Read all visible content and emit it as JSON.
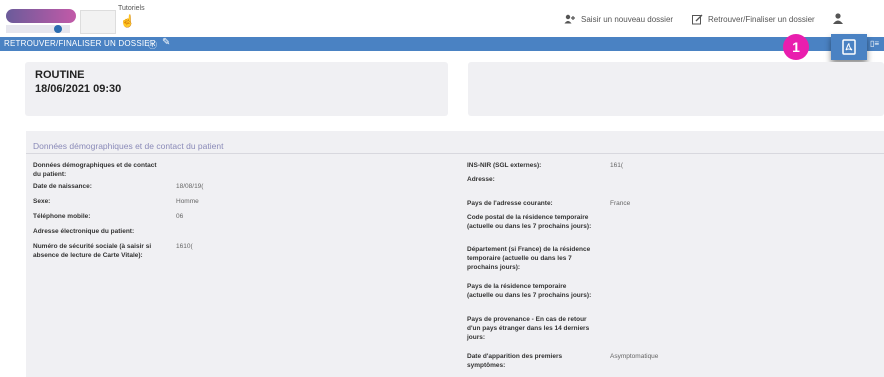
{
  "header": {
    "tutorials_label": "Tutoriels",
    "nav": {
      "new_file": "Saisir un nouveau dossier",
      "find_file": "Retrouver/Finaliser un dossier"
    }
  },
  "toolbar": {
    "title": "RETROUVER/FINALISER UN DOSSIER",
    "badge": "1",
    "accent_color": "#4a82c3",
    "badge_color": "#e91eae"
  },
  "summary": {
    "type": "ROUTINE",
    "datetime": "18/06/2021 09:30"
  },
  "section": {
    "title": "Données démographiques et de contact du patient",
    "left_fields": [
      {
        "label": "Données démographiques et de contact du patient:",
        "value": ""
      },
      {
        "label": "Date de naissance:",
        "value": "18/08/19("
      },
      {
        "label": "Sexe:",
        "value": "Homme"
      },
      {
        "label": "Téléphone mobile:",
        "value": "06"
      },
      {
        "label": "Adresse électronique du patient:",
        "value": ""
      },
      {
        "label": "Numéro de sécurité sociale (à saisir si absence de lecture de Carte Vitale):",
        "value": "1610("
      }
    ],
    "right_fields": [
      {
        "label": "INS-NIR (SGL externes):",
        "value": "161("
      },
      {
        "label": "Adresse:",
        "value": ""
      },
      {
        "label": "Pays de l'adresse courante:",
        "value": "France"
      },
      {
        "label": "Code postal de la résidence temporaire (actuelle ou dans les 7 prochains jours):",
        "value": ""
      },
      {
        "label": "Département (si France) de la résidence temporaire (actuelle ou dans les 7 prochains jours):",
        "value": ""
      },
      {
        "label": "Pays de la résidence temporaire (actuelle ou dans les 7 prochains jours):",
        "value": ""
      },
      {
        "label": "Pays de provenance - En cas de retour d'un pays étranger dans les 14 derniers jours:",
        "value": ""
      },
      {
        "label": "Date d'apparition des premiers symptômes:",
        "value": "Asymptomatique"
      }
    ]
  }
}
